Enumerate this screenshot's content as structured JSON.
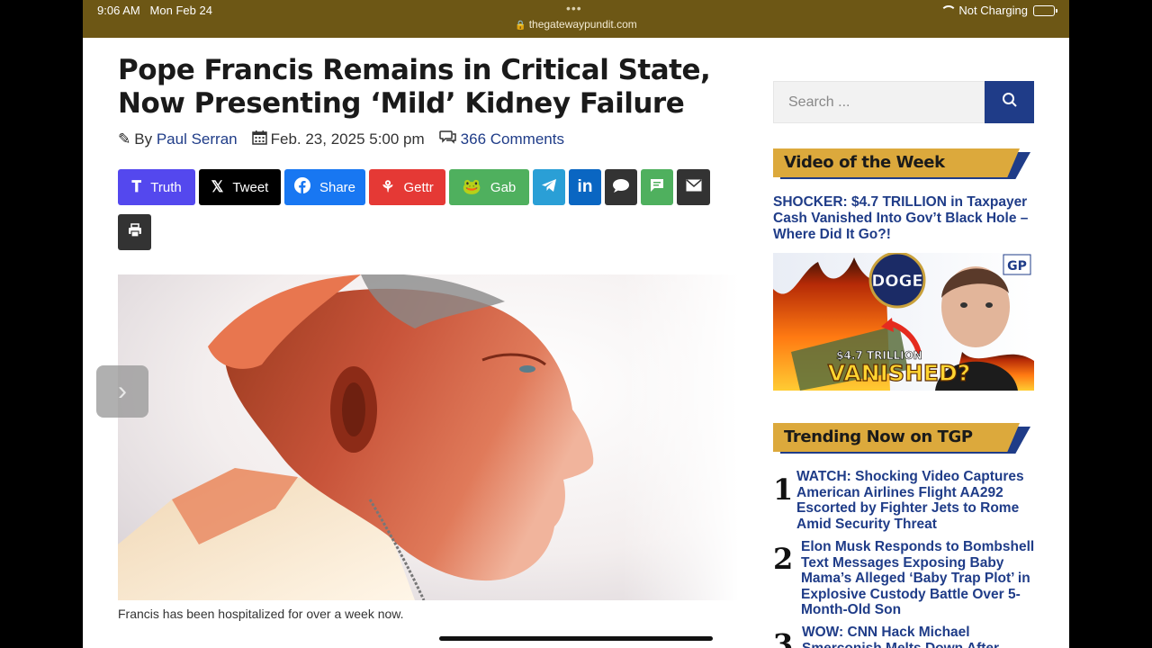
{
  "statusbar": {
    "time": "9:06 AM",
    "date": "Mon Feb 24",
    "url": "thegatewaypundit.com",
    "charging": "Not Charging"
  },
  "article": {
    "headline_line1": "Pope Francis Remains in Critical State,",
    "headline_line2": "Now Presenting ‘Mild’ Kidney Failure",
    "by": "By",
    "author": "Paul Serran",
    "date": "Feb. 23, 2025 5:00 pm",
    "comments": "366 Comments",
    "caption": "Francis has been hospitalized for over a week now."
  },
  "share_buttons": [
    {
      "label": "Truth",
      "icon": "truth-social-icon",
      "color": "#5448ee"
    },
    {
      "label": "Tweet",
      "icon": "x-icon",
      "color": "#000000"
    },
    {
      "label": "Share",
      "icon": "facebook-icon",
      "color": "#1877f2"
    },
    {
      "label": "Gettr",
      "icon": "gettr-icon",
      "color": "#e53935"
    },
    {
      "label": "Gab",
      "icon": "gab-icon",
      "color": "#4fb05e"
    },
    {
      "label": "",
      "icon": "telegram-icon",
      "color": "#2a9fd6"
    },
    {
      "label": "",
      "icon": "linkedin-icon",
      "color": "#0a66c2"
    },
    {
      "label": "",
      "icon": "comment-icon",
      "color": "#333333"
    },
    {
      "label": "",
      "icon": "sms-icon",
      "color": "#4fb05e"
    },
    {
      "label": "",
      "icon": "email-icon",
      "color": "#333333"
    },
    {
      "label": "",
      "icon": "print-icon",
      "color": "#333333"
    }
  ],
  "sidebar": {
    "search_placeholder": "Search ...",
    "video_section": "Video of the Week",
    "video_title": "SHOCKER: $4.7 TRILLION in Taxpayer Cash Vanished Into Gov’t Black Hole – Where Did It Go?!",
    "video_thumb_text_amount": "$4.7 TRILLION",
    "video_thumb_text_main": "VANISHED?",
    "video_thumb_badge": "GP",
    "video_thumb_logo": "DOGE",
    "trending_section": "Trending Now on TGP",
    "trending": [
      {
        "rank": "1",
        "title": "WATCH: Shocking Video Captures American Airlines Flight AA292 Escorted by Fighter Jets to Rome Amid Security Threat"
      },
      {
        "rank": "2",
        "title": "Elon Musk Responds to Bombshell Text Messages Exposing Baby Mama’s Alleged ‘Baby Trap Plot’ in Explosive Custody Battle Over 5-Month-Old Son"
      },
      {
        "rank": "3",
        "title": "WOW: CNN Hack Michael Smerconish Melts Down After"
      }
    ]
  }
}
